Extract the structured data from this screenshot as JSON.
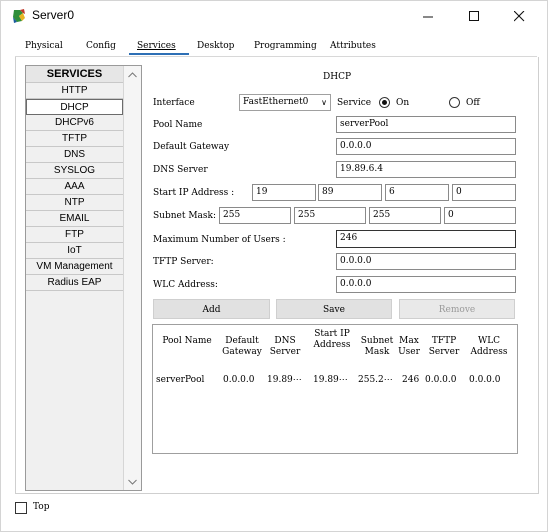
{
  "window": {
    "title": "Server0"
  },
  "tabs": [
    {
      "label": "Physical"
    },
    {
      "label": "Config"
    },
    {
      "label": "Services"
    },
    {
      "label": "Desktop"
    },
    {
      "label": "Programming"
    },
    {
      "label": "Attributes"
    }
  ],
  "sidebar": {
    "header": "SERVICES",
    "items": [
      {
        "label": "HTTP"
      },
      {
        "label": "DHCP"
      },
      {
        "label": "DHCPv6"
      },
      {
        "label": "TFTP"
      },
      {
        "label": "DNS"
      },
      {
        "label": "SYSLOG"
      },
      {
        "label": "AAA"
      },
      {
        "label": "NTP"
      },
      {
        "label": "EMAIL"
      },
      {
        "label": "FTP"
      },
      {
        "label": "IoT"
      },
      {
        "label": "VM Management"
      },
      {
        "label": "Radius EAP"
      }
    ],
    "selected": "DHCP"
  },
  "dhcp": {
    "title": "DHCP",
    "interface_label": "Interface",
    "interface_value": "FastEthernet0",
    "service_label": "Service",
    "on_label": "On",
    "off_label": "Off",
    "pool_name_label": "Pool Name",
    "pool_name": "serverPool",
    "default_gateway_label": "Default Gateway",
    "default_gateway": "0.0.0.0",
    "dns_server_label": "DNS Server",
    "dns_server": "19.89.6.4",
    "start_ip_label": "Start IP Address :",
    "start_ip": [
      "19",
      "89",
      "6",
      "0"
    ],
    "subnet_mask_label": "Subnet Mask:",
    "subnet_mask": [
      "255",
      "255",
      "255",
      "0"
    ],
    "max_users_label": "Maximum Number of Users :",
    "max_users": "246",
    "tftp_label": "TFTP Server:",
    "tftp": "0.0.0.0",
    "wlc_label": "WLC Address:",
    "wlc": "0.0.0.0",
    "add_label": "Add",
    "save_label": "Save",
    "remove_label": "Remove"
  },
  "table": {
    "columns": [
      "Pool Name",
      "Default Gateway",
      "DNS Server",
      "Start IP Address",
      "Subnet Mask",
      "Max User",
      "TFTP Server",
      "WLC Address"
    ],
    "rows": [
      [
        "serverPool",
        "0.0.0.0",
        "19.89⋯",
        "19.89⋯",
        "255.2⋯",
        "246",
        "0.0.0.0",
        "0.0.0.0"
      ]
    ]
  },
  "bottom": {
    "top_label": "Top"
  },
  "colors": {
    "accent": "#2d6fb5",
    "sidebar_bg": "#f0f0f0"
  }
}
